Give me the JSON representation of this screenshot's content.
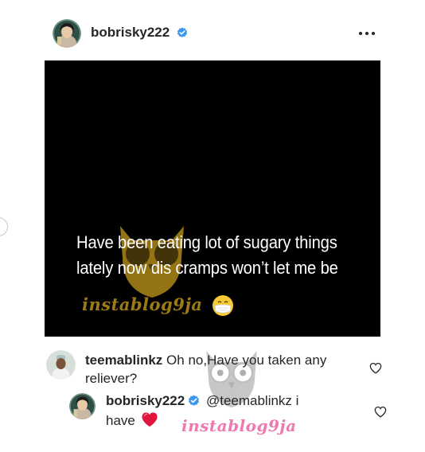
{
  "post": {
    "author": "bobrisky222",
    "media_caption": [
      "Have been eating lot of sugary things",
      "lately now dis cramps won’t let me be"
    ],
    "watermark": "instablog9ja"
  },
  "comments": [
    {
      "username": "teemablinkz",
      "text": "Oh no,Have you taken any reliever?"
    },
    {
      "username": "bobrisky222",
      "mention": "@teemablinkz",
      "text_line1": "i",
      "text_line2": "have"
    }
  ],
  "icons": {
    "verified": "verified-badge-icon",
    "more": "more-options-icon",
    "like": "heart-outline-icon",
    "heart_emoji": "red-heart-emoji",
    "face_emoji": "face-with-medical-mask-emoji"
  },
  "colors": {
    "verified": "#3897f0",
    "media_bg": "#000000",
    "watermark_yellow": "#c59a1a",
    "watermark_pink": "#e94d96"
  }
}
